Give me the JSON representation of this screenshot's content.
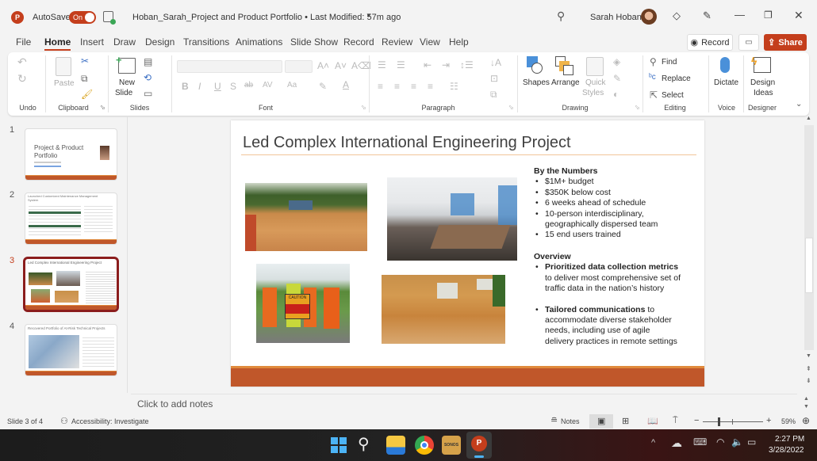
{
  "titlebar": {
    "app_icon": "powerpoint-icon",
    "autosave_label": "AutoSave",
    "autosave_state": "On",
    "doc_title": "Hoban_Sarah_Project and Product Portfolio • Last Modified: 57m ago",
    "user_name": "Sarah Hoban"
  },
  "tabs": [
    "File",
    "Home",
    "Insert",
    "Draw",
    "Design",
    "Transitions",
    "Animations",
    "Slide Show",
    "Record",
    "Review",
    "View",
    "Help"
  ],
  "active_tab": "Home",
  "actions": {
    "record": "Record",
    "share": "Share"
  },
  "ribbon": {
    "groups": [
      "Undo",
      "Clipboard",
      "Slides",
      "Font",
      "Paragraph",
      "Drawing",
      "Editing",
      "Voice",
      "Designer"
    ],
    "paste": "Paste",
    "new_slide_1": "New",
    "new_slide_2": "Slide",
    "shapes": "Shapes",
    "arrange": "Arrange",
    "quick_styles_1": "Quick",
    "quick_styles_2": "Styles",
    "find": "Find",
    "replace": "Replace",
    "select": "Select",
    "dictate": "Dictate",
    "design_ideas_1": "Design",
    "design_ideas_2": "Ideas",
    "font_buttons": [
      "B",
      "I",
      "U",
      "S",
      "ab",
      "AV",
      "Aa"
    ]
  },
  "thumbnails": [
    {
      "num": "1",
      "title": "Project & Product Portfolio"
    },
    {
      "num": "2",
      "title": "Launched Customized Maintenance Management System"
    },
    {
      "num": "3",
      "title": "Led Complex International Engineering Project"
    },
    {
      "num": "4",
      "title": "Recovered Portfolio of At-Risk Technical Projects"
    }
  ],
  "slide": {
    "title": "Led Complex International Engineering Project",
    "numbers_heading": "By the Numbers",
    "numbers": [
      "$1M+ budget",
      "$350K below cost",
      "6 weeks ahead of schedule",
      "10-person interdisciplinary, geographically dispersed team",
      "15 end users trained"
    ],
    "overview_heading": "Overview",
    "overview": [
      {
        "bold": "Prioritized data collection metrics",
        "rest": " to deliver most comprehensive set of traffic data in the nation’s history"
      },
      {
        "bold": "Tailored communications",
        "rest": " to accommodate diverse stakeholder needs, including use of agile delivery practices in remote settings"
      }
    ],
    "caution_sign": "CAUTION"
  },
  "notes_placeholder": "Click to add notes",
  "status": {
    "slide_count": "Slide 3 of 4",
    "accessibility": "Accessibility: Investigate",
    "notes": "Notes",
    "zoom": "59%",
    "zoom_fraction": 0.59
  },
  "taskbar": {
    "time": "2:27 PM",
    "date": "3/28/2022",
    "sonos": "SONOS"
  },
  "colors": {
    "accent": "#c43e1c",
    "slide_bar": "#c0572a",
    "slide_bar_top": "#e08a3c"
  }
}
